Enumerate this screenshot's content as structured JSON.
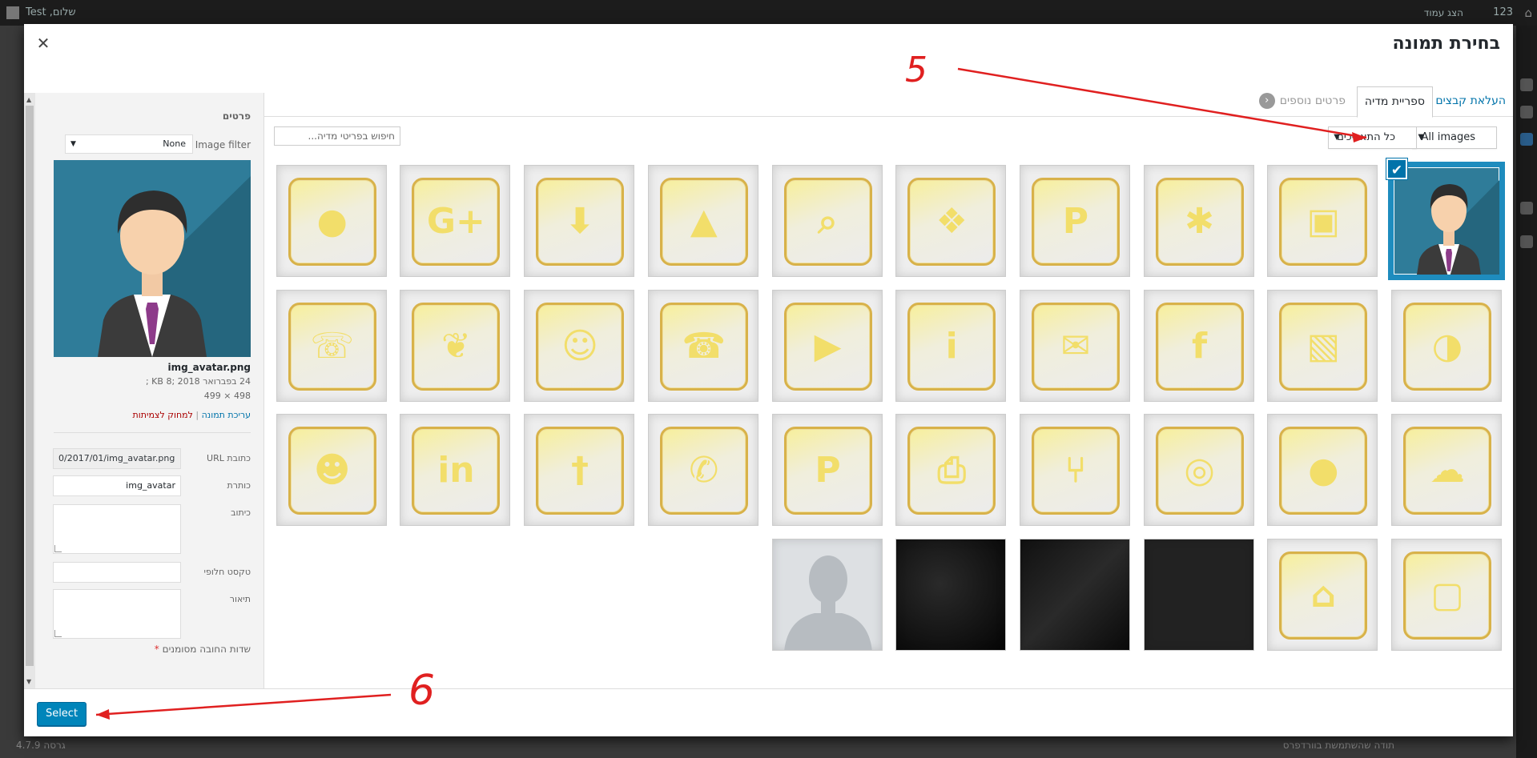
{
  "admin_bar": {
    "count": "123",
    "view_page": "הצג עמוד",
    "greeting": "שלום, Test"
  },
  "footer": {
    "thanks": "תודה שהשתמשת בוורדפרס",
    "version": "גרסה 4.7.9"
  },
  "modal": {
    "title": "בחירת תמונה",
    "close_icon": "close-icon",
    "tabs": [
      {
        "label": "העלאת קבצים",
        "active": false
      },
      {
        "label": "ספריית מדיה",
        "active": true
      },
      {
        "label": "פרטים נוספים",
        "active": false
      }
    ]
  },
  "toolbar": {
    "type_filter": "All images",
    "date_filter": "כל התאריכים",
    "search_placeholder": "חיפוש בפריטי מדיה..."
  },
  "grid": {
    "items": [
      {
        "icon": "avatar-photo",
        "selected": true
      },
      {
        "icon": "presentation-icon"
      },
      {
        "icon": "network-icon"
      },
      {
        "icon": "paypal-icon"
      },
      {
        "icon": "gift-icon"
      },
      {
        "icon": "search-alert-icon"
      },
      {
        "icon": "graduation-cap-icon"
      },
      {
        "icon": "shopping-cart-icon"
      },
      {
        "icon": "google-plus-icon"
      },
      {
        "icon": "map-pin-icon"
      },
      {
        "icon": "globe-icon"
      },
      {
        "icon": "gallery-icon"
      },
      {
        "icon": "facebook-icon"
      },
      {
        "icon": "mail-icon"
      },
      {
        "icon": "info-icon"
      },
      {
        "icon": "youtube-icon"
      },
      {
        "icon": "whatsapp-icon"
      },
      {
        "icon": "waze-icon"
      },
      {
        "icon": "twitter-icon"
      },
      {
        "icon": "telephone-icon"
      },
      {
        "icon": "soundcloud-icon"
      },
      {
        "icon": "speech-bubble-icon"
      },
      {
        "icon": "web-icon"
      },
      {
        "icon": "share-icon"
      },
      {
        "icon": "printer-icon"
      },
      {
        "icon": "pinterest-icon"
      },
      {
        "icon": "phone-icon"
      },
      {
        "icon": "restaurant-icon"
      },
      {
        "icon": "linkedin-icon"
      },
      {
        "icon": "users-icon"
      },
      {
        "icon": "instagram-icon"
      },
      {
        "icon": "home-icon"
      },
      {
        "icon": "dark-texture-plain"
      },
      {
        "icon": "dark-texture-hex"
      },
      {
        "icon": "dark-texture-leather"
      },
      {
        "icon": "default-avatar-silhouette"
      }
    ]
  },
  "details": {
    "title": "פרטים",
    "image_filter_label": "Image filter",
    "image_filter_value": "None",
    "file_name": "img_avatar.png",
    "date_size": "24 בפברואר 2018 ;8 KB ;",
    "dimensions": "498 × 499",
    "edit_link": "עריכת תמונה",
    "delete_link": "למחוק לצמיתות",
    "fields": {
      "url_label": "כתובת URL",
      "url_value": "0/2017/01/img_avatar.png",
      "title_label": "כותרת",
      "title_value": "img_avatar",
      "caption_label": "כיתוב",
      "alt_label": "טקסט חלופי",
      "description_label": "תיאור"
    },
    "required_note": "שדות החובה מסומנים",
    "required_star": "*"
  },
  "bottom": {
    "select_label": "Select"
  },
  "annotations": {
    "step5": "5",
    "step6": "6",
    "color": "#e02020"
  }
}
